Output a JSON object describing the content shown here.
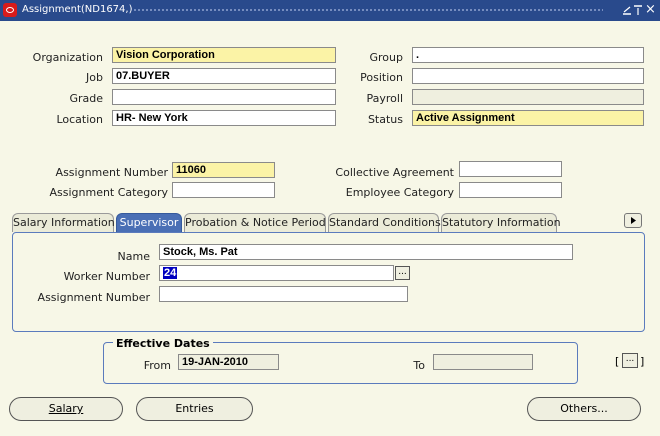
{
  "window": {
    "title": "Assignment(ND1674,)",
    "minimize_icon": "minimize-icon",
    "maximize_icon": "maximize-icon",
    "close_label": "×"
  },
  "top_fields": {
    "organization": {
      "label": "Organization",
      "value": "Vision Corporation"
    },
    "job": {
      "label": "Job",
      "value": "07.BUYER"
    },
    "grade": {
      "label": "Grade",
      "value": ""
    },
    "location": {
      "label": "Location",
      "value": "HR- New York"
    },
    "group": {
      "label": "Group",
      "value": "."
    },
    "position": {
      "label": "Position",
      "value": ""
    },
    "payroll": {
      "label": "Payroll",
      "value": ""
    },
    "status": {
      "label": "Status",
      "value": "Active Assignment"
    }
  },
  "mid_fields": {
    "assignment_number": {
      "label": "Assignment Number",
      "value": "11060"
    },
    "assignment_category": {
      "label": "Assignment Category",
      "value": ""
    },
    "collective_agreement": {
      "label": "Collective Agreement",
      "value": ""
    },
    "employee_category": {
      "label": "Employee Category",
      "value": ""
    }
  },
  "tabs": [
    {
      "label": "Salary Information",
      "active": false
    },
    {
      "label": "Supervisor",
      "active": true
    },
    {
      "label": "Probation & Notice Period",
      "active": false
    },
    {
      "label": "Standard Conditions",
      "active": false
    },
    {
      "label": "Statutory Information",
      "active": false
    }
  ],
  "supervisor": {
    "name": {
      "label": "Name",
      "value": "Stock, Ms. Pat"
    },
    "worker_number": {
      "label": "Worker Number",
      "value": "24"
    },
    "assignment_number": {
      "label": "Assignment Number",
      "value": ""
    }
  },
  "effective_dates": {
    "title": "Effective Dates",
    "from_label": "From",
    "from_value": "19-JAN-2010",
    "to_label": "To",
    "to_value": ""
  },
  "buttons": {
    "salary": "Salary",
    "entries": "Entries",
    "others": "Others...",
    "ellipsis": "...",
    "bracket_left": "[",
    "bracket_right": "]"
  },
  "colors": {
    "titlebar": "#294a8c",
    "required_field": "#fbf3a6",
    "active_tab": "#4a6fb5",
    "background": "#f7f7e7"
  }
}
